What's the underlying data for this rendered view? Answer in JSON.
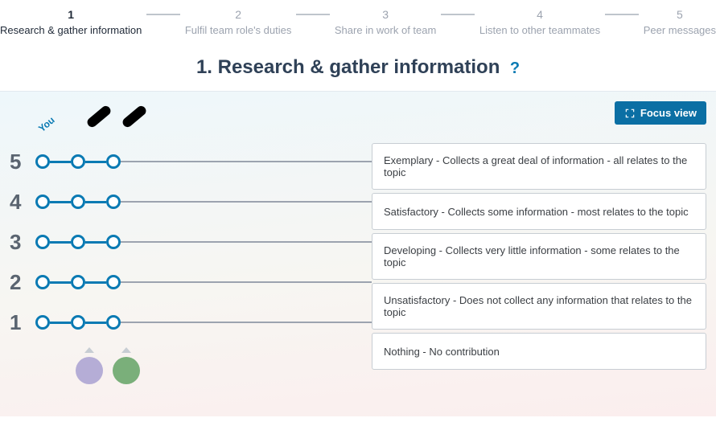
{
  "stepper": {
    "steps": [
      {
        "num": "1",
        "label": "Research & gather information",
        "active": true
      },
      {
        "num": "2",
        "label": "Fulfil team role's duties",
        "active": false
      },
      {
        "num": "3",
        "label": "Share in work of team",
        "active": false
      },
      {
        "num": "4",
        "label": "Listen to other teammates",
        "active": false
      },
      {
        "num": "5",
        "label": "Peer messages",
        "active": false
      }
    ]
  },
  "heading": {
    "title": "1. Research & gather information",
    "help_symbol": "?"
  },
  "focus_view_label": "Focus view",
  "you_label": "You",
  "rubric": {
    "rows": [
      {
        "num": "5",
        "desc": "Exemplary - Collects a great deal of information - all relates to the topic"
      },
      {
        "num": "4",
        "desc": "Satisfactory - Collects some information - most relates to the topic"
      },
      {
        "num": "3",
        "desc": "Developing - Collects very little information - some relates to the topic"
      },
      {
        "num": "2",
        "desc": "Unsatisfactory - Does not collect any information that relates to the topic"
      },
      {
        "num": "1",
        "desc": "Nothing - No contribution"
      }
    ]
  },
  "peer_markers": {
    "colors": [
      "#b5add6",
      "#7aaf7a"
    ]
  }
}
